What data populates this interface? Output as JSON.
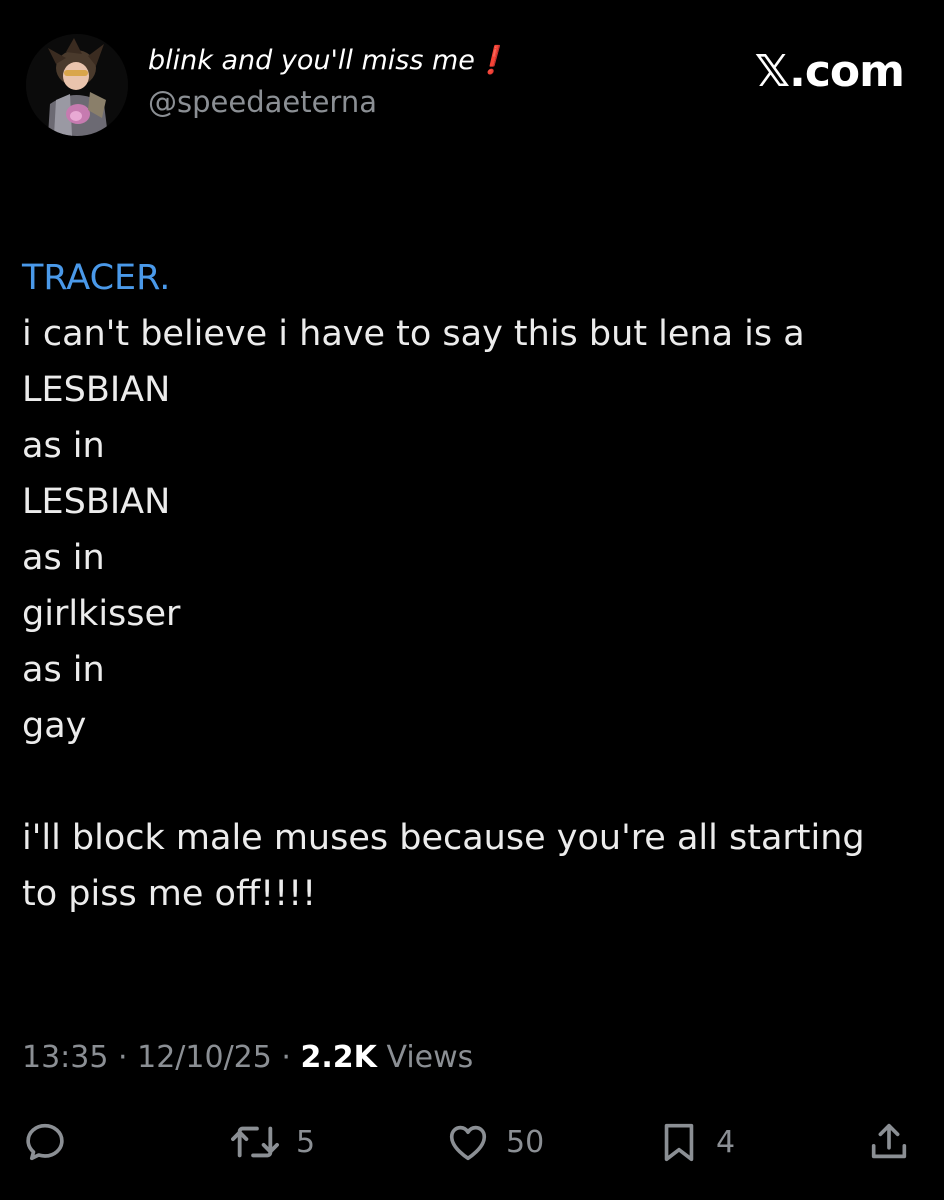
{
  "header": {
    "display_name": "blink and you'll miss me❗",
    "handle": "@speedaeterna",
    "site_mark": "𝕏.com",
    "avatar_icon": "avatar-icon"
  },
  "tweet": {
    "lines": [
      "TRACER.",
      "i can't believe i have to say this but lena is a",
      "LESBIAN",
      "as in",
      "LESBIAN",
      "as in",
      "girlkisser",
      "as in",
      "gay",
      "",
      "i'll block male muses because you're all starting",
      "to piss me off!!!!"
    ],
    "mention_color": "#4a99e9"
  },
  "meta": {
    "time": "13:35",
    "separator": "·",
    "date": "12/10/25",
    "views_count": "2.2K",
    "views_label": "Views"
  },
  "actions": {
    "reply": {
      "icon": "reply-icon",
      "count": ""
    },
    "repost": {
      "icon": "repost-icon",
      "count": "5"
    },
    "like": {
      "icon": "heart-icon",
      "count": "50"
    },
    "bookmark": {
      "icon": "bookmark-icon",
      "count": "4"
    },
    "share": {
      "icon": "share-icon",
      "count": ""
    }
  }
}
